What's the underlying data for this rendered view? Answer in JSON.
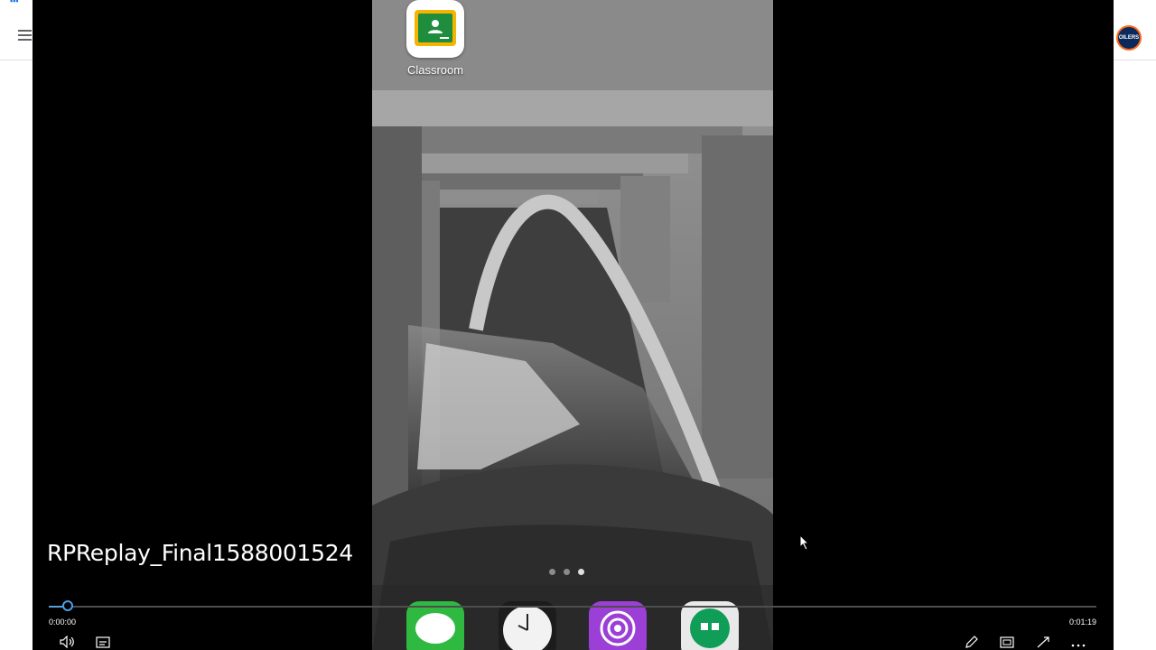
{
  "background_window": {
    "apps_icon": "apps-grid-icon",
    "menu_icon": "hamburger-menu-icon",
    "avatar_text": "OILERS"
  },
  "player": {
    "video_title": "RPReplay_Final1588001524",
    "progress_fraction": 0.018,
    "time_elapsed": "0:00:00",
    "time_total": "0:01:19",
    "accent_color": "#4aa0e6",
    "controls": {
      "volume_icon": "volume-icon",
      "captions_icon": "captions-icon",
      "edit_icon": "edit-pencil-icon",
      "miniview_icon": "mini-view-icon",
      "fullscreen_icon": "fullscreen-icon",
      "more_icon": "more-options-icon"
    }
  },
  "phone_screen": {
    "app_label": "Classroom",
    "page_count": 3,
    "active_page": 3,
    "dock_apps": [
      "messages-icon",
      "clock-icon",
      "podcasts-icon",
      "hangouts-icon"
    ]
  }
}
